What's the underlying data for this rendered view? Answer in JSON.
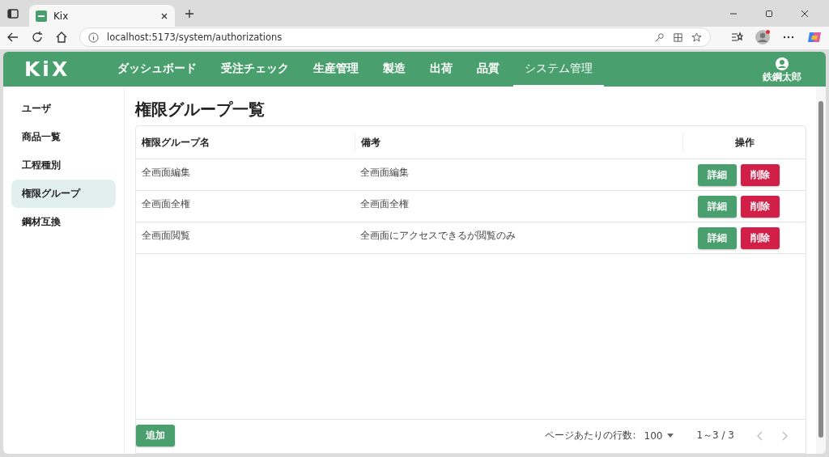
{
  "browser": {
    "tab_title": "Kix",
    "url": "localhost:5173/system/authorizations"
  },
  "app": {
    "logo": "KiX",
    "nav": [
      {
        "label": "ダッシュボード",
        "selected": false
      },
      {
        "label": "受注チェック",
        "selected": false
      },
      {
        "label": "生産管理",
        "selected": false
      },
      {
        "label": "製造",
        "selected": false
      },
      {
        "label": "出荷",
        "selected": false
      },
      {
        "label": "品質",
        "selected": false
      },
      {
        "label": "システム管理",
        "selected": true
      }
    ],
    "user_name": "鉄鋼太郎"
  },
  "sidebar": {
    "items": [
      {
        "label": "ユーザ",
        "selected": false
      },
      {
        "label": "商品一覧",
        "selected": false
      },
      {
        "label": "工程種別",
        "selected": false
      },
      {
        "label": "権限グループ",
        "selected": true
      },
      {
        "label": "鋼材互換",
        "selected": false
      }
    ]
  },
  "page_title": "権限グループ一覧",
  "table": {
    "columns": [
      "権限グループ名",
      "備考",
      "操作"
    ],
    "rows": [
      {
        "name": "全画面編集",
        "note": "全画面編集",
        "actions": [
          {
            "label": "詳細",
            "kind": "primary"
          },
          {
            "label": "削除",
            "kind": "danger"
          }
        ]
      },
      {
        "name": "全画面全権",
        "note": "全画面全権",
        "actions": [
          {
            "label": "詳細",
            "kind": "primary"
          },
          {
            "label": "削除",
            "kind": "danger"
          }
        ]
      },
      {
        "name": "全画面閲覧",
        "note": "全画面にアクセスできるが閲覧のみ",
        "actions": [
          {
            "label": "詳細",
            "kind": "primary"
          },
          {
            "label": "削除",
            "kind": "danger"
          }
        ]
      }
    ]
  },
  "footer": {
    "add_button": "追加",
    "rows_per_page_label": "ページあたりの行数:",
    "rows_per_page_value": "100",
    "range": "1～3 / 3"
  }
}
